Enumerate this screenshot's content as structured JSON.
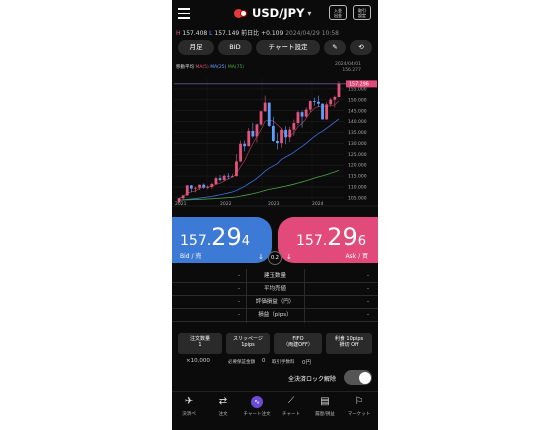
{
  "header": {
    "pair": "USD/JPY",
    "btn1": "入金\n出金",
    "btn2": "取引\n設定"
  },
  "quote": {
    "high": "157.408",
    "low": "157.149",
    "change_label": "前日比",
    "change": "+0.109",
    "time": "2024/04/29 10:58"
  },
  "toolbar": {
    "period": "月足",
    "side": "BID",
    "chart_settings": "チャート設定"
  },
  "chart_legend": {
    "label": "移動平均",
    "ma5": "MA(5)",
    "ma25": "MA(25)",
    "ma75": "MA(75)"
  },
  "chart_ohlc": [
    "2024/04/01",
    "156.277"
  ],
  "chart_data": {
    "type": "candlestick",
    "x_labels": [
      "2021",
      "2022",
      "2023",
      "2024"
    ],
    "y_ticks": [
      "155.000",
      "150.000",
      "145.000",
      "140.000",
      "135.000",
      "130.000",
      "125.000",
      "120.000",
      "115.000",
      "110.000",
      "105.000"
    ],
    "ylim": [
      104,
      160
    ],
    "current_price_label": "157.296",
    "candles": [
      [
        103.2,
        104.9,
        102.6,
        104.8
      ],
      [
        104.8,
        106.3,
        104.2,
        106.1
      ],
      [
        106.1,
        110.9,
        106.0,
        110.7
      ],
      [
        110.7,
        110.9,
        107.5,
        109.3
      ],
      [
        109.3,
        110.2,
        107.5,
        109.6
      ],
      [
        109.6,
        111.1,
        108.6,
        111.0
      ],
      [
        111.0,
        111.6,
        109.1,
        109.7
      ],
      [
        109.7,
        110.8,
        109.0,
        110.0
      ],
      [
        110.0,
        112.0,
        109.1,
        111.3
      ],
      [
        111.3,
        114.7,
        111.0,
        114.0
      ],
      [
        114.0,
        115.5,
        112.5,
        113.2
      ],
      [
        113.2,
        115.8,
        112.5,
        115.1
      ],
      [
        115.1,
        116.4,
        113.5,
        115.0
      ],
      [
        115.0,
        116.0,
        114.3,
        115.0
      ],
      [
        115.0,
        125.1,
        114.6,
        121.7
      ],
      [
        121.7,
        131.3,
        121.3,
        129.8
      ],
      [
        129.8,
        131.3,
        126.4,
        128.7
      ],
      [
        128.7,
        137.0,
        128.6,
        135.7
      ],
      [
        135.7,
        139.4,
        132.5,
        133.2
      ],
      [
        133.2,
        139.1,
        130.4,
        138.7
      ],
      [
        138.7,
        145.0,
        138.0,
        144.7
      ],
      [
        144.7,
        151.9,
        144.5,
        148.7
      ],
      [
        148.7,
        148.8,
        137.5,
        138.0
      ],
      [
        138.0,
        142.2,
        130.6,
        131.1
      ],
      [
        131.1,
        134.8,
        127.2,
        130.1
      ],
      [
        130.1,
        136.9,
        128.0,
        136.2
      ],
      [
        136.2,
        137.9,
        129.6,
        132.8
      ],
      [
        132.8,
        137.7,
        130.6,
        136.3
      ],
      [
        136.3,
        140.9,
        133.5,
        139.3
      ],
      [
        139.3,
        145.1,
        138.4,
        144.3
      ],
      [
        144.3,
        145.1,
        137.2,
        142.3
      ],
      [
        142.3,
        146.6,
        141.5,
        145.5
      ],
      [
        145.5,
        149.7,
        144.4,
        149.4
      ],
      [
        149.4,
        151.0,
        147.3,
        149.1
      ],
      [
        149.1,
        151.9,
        146.7,
        148.2
      ],
      [
        148.2,
        148.4,
        140.9,
        141.0
      ],
      [
        141.0,
        148.8,
        140.8,
        147.9
      ],
      [
        147.9,
        150.9,
        146.9,
        150.1
      ],
      [
        150.1,
        151.9,
        146.4,
        151.3
      ],
      [
        151.3,
        158.4,
        151.0,
        157.3
      ]
    ]
  },
  "bid": {
    "prefix": "157.",
    "big": "29",
    "small": "4",
    "label": "Bid / 売"
  },
  "ask": {
    "prefix": "157.",
    "big": "29",
    "small": "6",
    "label": "Ask / 買"
  },
  "spread": "0.2",
  "info_rows": [
    {
      "left": "-",
      "center": "建玉数量",
      "right": "-"
    },
    {
      "left": "-",
      "center": "平均売値",
      "right": "-"
    },
    {
      "left": "-",
      "center": "評価損益（円）",
      "right": "-"
    },
    {
      "left": "-",
      "center": "損益（pips）",
      "right": "-"
    }
  ],
  "settings": {
    "qty": {
      "label": "注文数量",
      "value": "1"
    },
    "slippage": {
      "label": "スリッページ",
      "value": "1pips"
    },
    "fifo": {
      "label": "FIFO",
      "value": "（両建OFF）"
    },
    "profit": {
      "label": "利食 10pips",
      "value": "損切 Off"
    },
    "unit": "×10,000",
    "margin_label": "必要保証金額",
    "margin_value": "0",
    "fee_label": "取引手数料",
    "fee_value": "0円"
  },
  "lock_label": "全決済ロック解除",
  "nav": [
    {
      "label": "決済ペ",
      "icon": "✈"
    },
    {
      "label": "注文",
      "icon": "⇄"
    },
    {
      "label": "チャート注文",
      "icon": "∿"
    },
    {
      "label": "チャート",
      "icon": "📈"
    },
    {
      "label": "履歴/損益",
      "icon": "▤"
    },
    {
      "label": "マーケット",
      "icon": "⚐"
    }
  ],
  "colors": {
    "bid": "#3d7ad6",
    "ask": "#e24a7c",
    "up": "#e3547c",
    "down": "#5fa0ff",
    "ma25": "#3f6fe0",
    "ma75": "#4aa24a"
  }
}
